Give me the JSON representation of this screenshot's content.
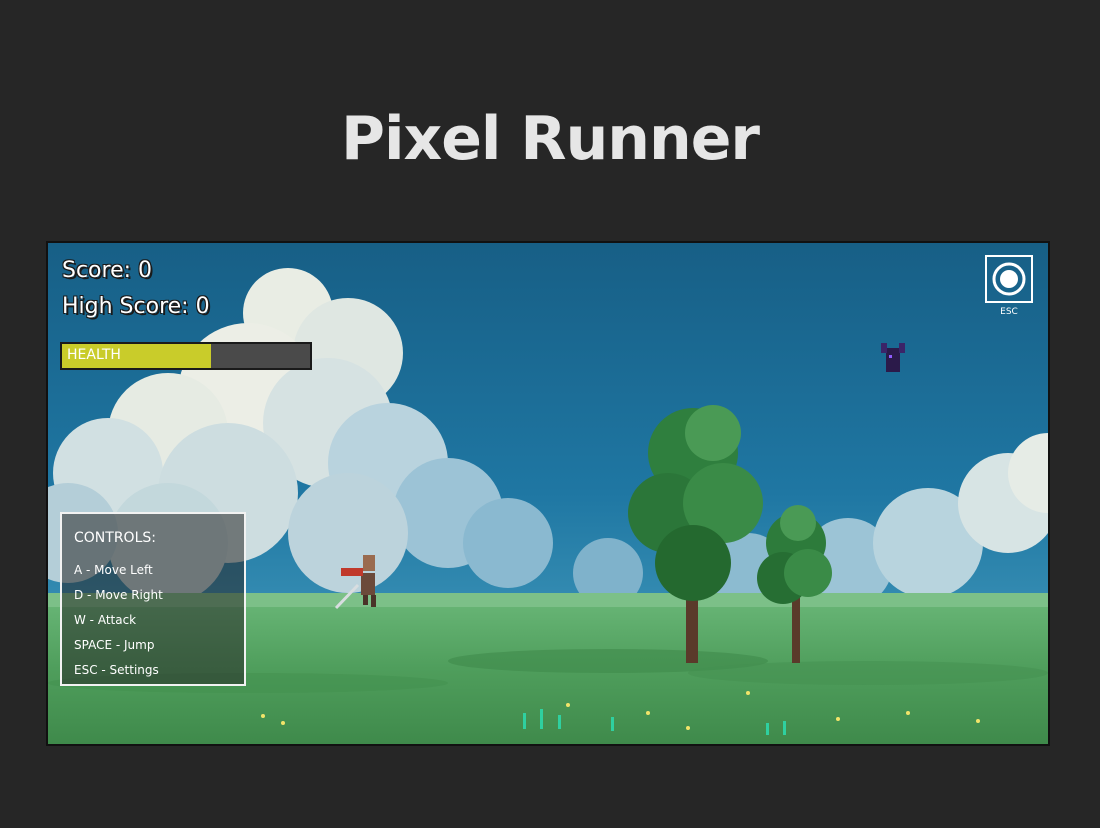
{
  "page": {
    "title": "Pixel Runner"
  },
  "hud": {
    "score_text": "Score: 0",
    "high_score_text": "High Score: 0",
    "health_label": "HEALTH",
    "health_fraction": 0.6,
    "health_color": "#c9cc2a"
  },
  "settings": {
    "label": "ESC",
    "icon": "settings-ring-icon"
  },
  "controls": {
    "title": "CONTROLS:",
    "items": [
      "A - Move Left",
      "D - Move Right",
      "W - Attack",
      "SPACE - Jump",
      "ESC - Settings"
    ]
  },
  "colors": {
    "background": "#262626",
    "sky": "#1f6e96",
    "grass": "#5fae6a"
  }
}
